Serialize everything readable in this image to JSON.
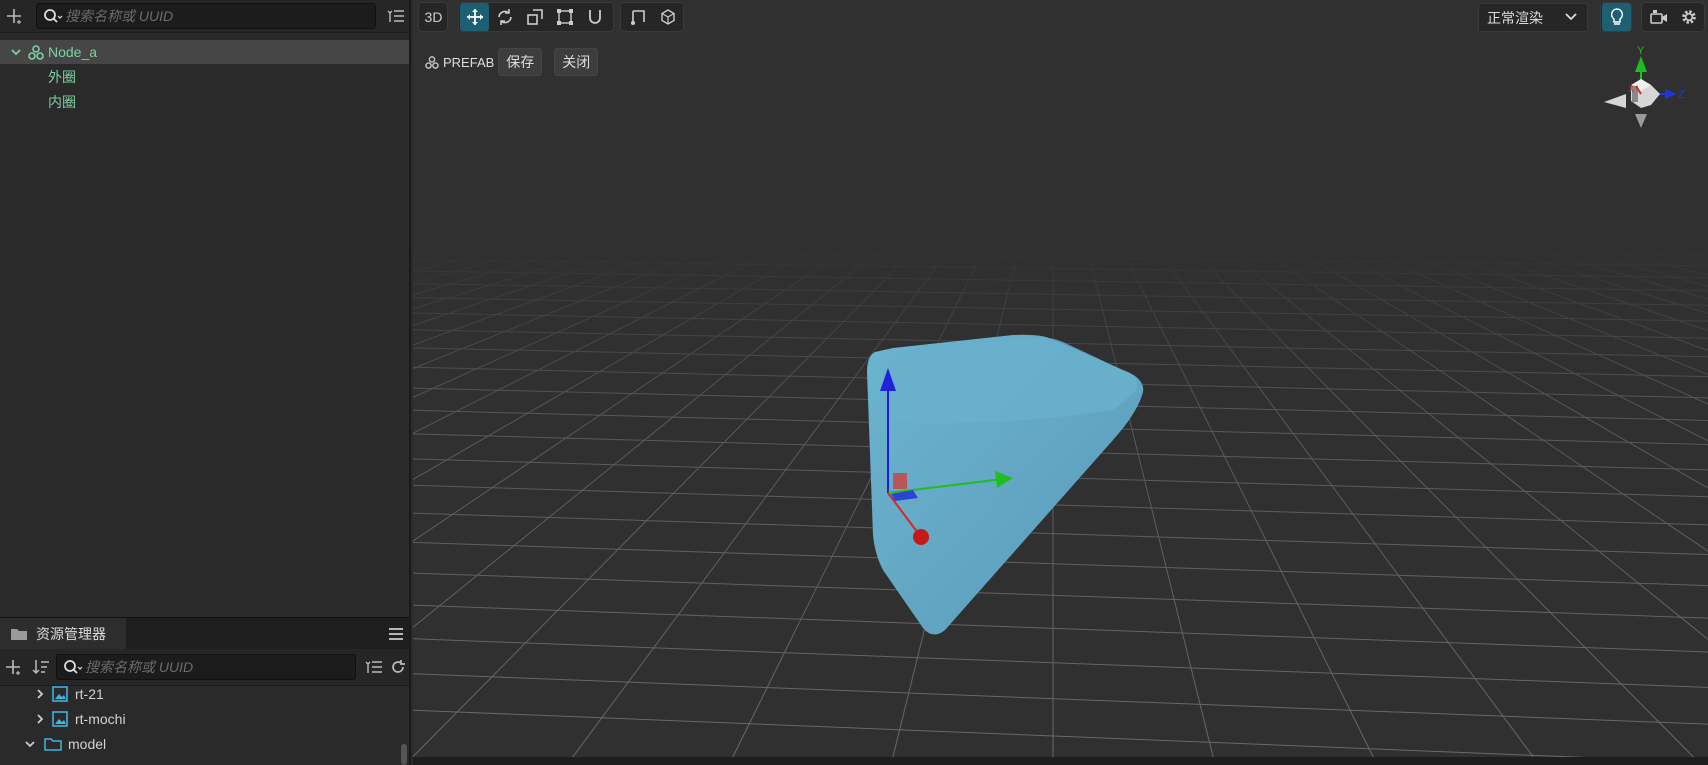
{
  "hierarchy": {
    "search_placeholder": "搜索名称或 UUID",
    "nodes": [
      {
        "label": "Node_a",
        "expanded": true,
        "selected": true
      },
      {
        "label": "外圈"
      },
      {
        "label": "内圈"
      }
    ]
  },
  "assets": {
    "title": "资源管理器",
    "search_placeholder": "搜索名称或 UUID",
    "items": [
      {
        "label": "rt-21",
        "type": "image",
        "expanded": false
      },
      {
        "label": "rt-mochi",
        "type": "image",
        "expanded": false
      },
      {
        "label": "model",
        "type": "folder",
        "expanded": true
      }
    ]
  },
  "scene": {
    "mode_3d": "3D",
    "prefab_label": "PREFAB",
    "save_label": "保存",
    "close_label": "关闭",
    "render_mode": "正常渲染",
    "gizmo_y": "Y",
    "gizmo_z": "Z",
    "gizmo_x": "X"
  },
  "colors": {
    "accent": "#1d5f73",
    "node_green": "#7ed0a2",
    "mesh": "#5fa6c2"
  },
  "icons": [
    "add-icon",
    "search-icon",
    "list-filter-icon",
    "chevron-down-icon",
    "prefab-node-icon",
    "folder-icon",
    "menu-icon",
    "sort-icon",
    "refresh-icon",
    "move-icon",
    "rotate-icon",
    "scale-icon",
    "rect-icon",
    "snap-icon",
    "local-global-icon",
    "pivot-icon",
    "light-bulb-icon",
    "camera-icon",
    "gear-icon",
    "image-icon",
    "chevron-right-icon"
  ]
}
